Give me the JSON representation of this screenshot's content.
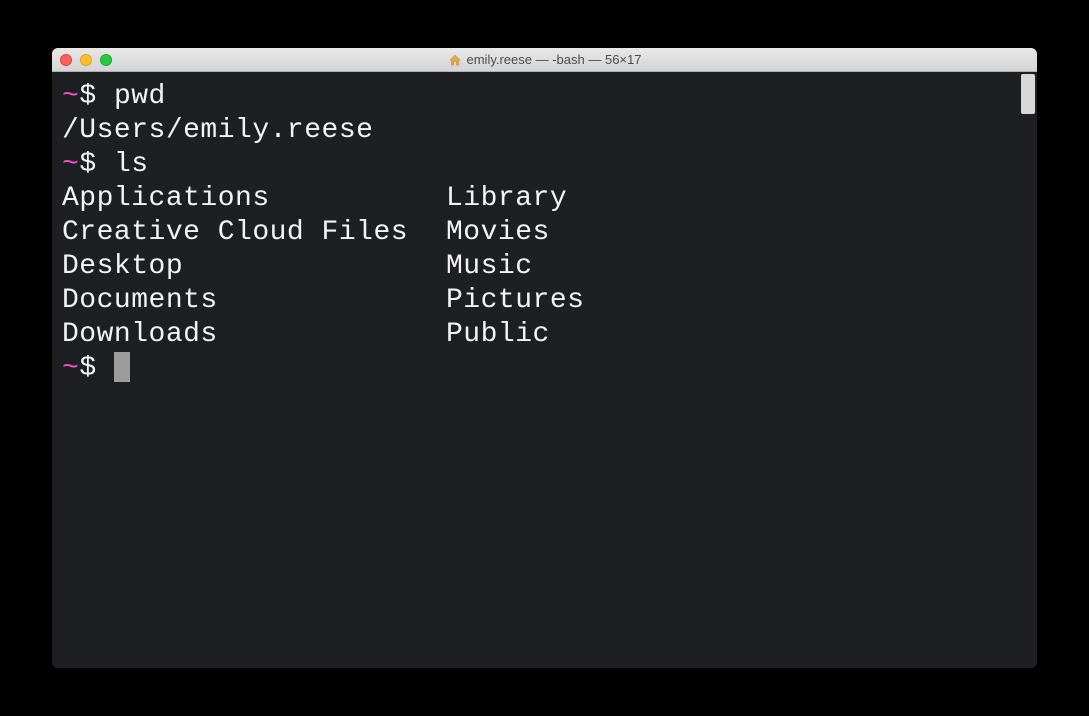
{
  "window": {
    "title": "emily.reese — -bash — 56×17"
  },
  "terminal": {
    "prompt_tilde": "~",
    "prompt_dollar": "$",
    "lines": [
      {
        "cmd": "pwd"
      },
      {
        "out": "/Users/emily.reese"
      },
      {
        "cmd": "ls"
      }
    ],
    "ls_columns": {
      "col1": [
        "Applications",
        "Creative Cloud Files",
        "Desktop",
        "Documents",
        "Downloads"
      ],
      "col2": [
        "Library",
        "Movies",
        "Music",
        "Pictures",
        "Public"
      ]
    }
  }
}
